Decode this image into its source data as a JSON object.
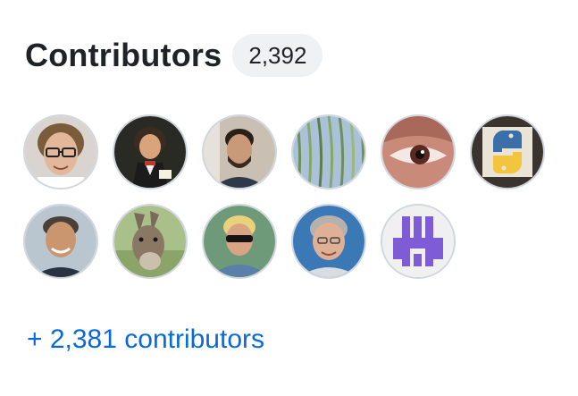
{
  "contributors": {
    "title": "Contributors",
    "count": "2,392",
    "more_link": "+ 2,381 contributors",
    "link_color": "#0969da",
    "avatars": [
      {
        "icon": "avatar-man-glasses"
      },
      {
        "icon": "avatar-beethoven-painting"
      },
      {
        "icon": "avatar-man-beard"
      },
      {
        "icon": "avatar-willow-tree"
      },
      {
        "icon": "avatar-eye-closeup"
      },
      {
        "icon": "avatar-python-logo"
      },
      {
        "icon": "avatar-man-smiling"
      },
      {
        "icon": "avatar-donkey"
      },
      {
        "icon": "avatar-man-sunglasses"
      },
      {
        "icon": "avatar-man-grey-hair"
      },
      {
        "icon": "avatar-identicon-purple"
      }
    ]
  }
}
